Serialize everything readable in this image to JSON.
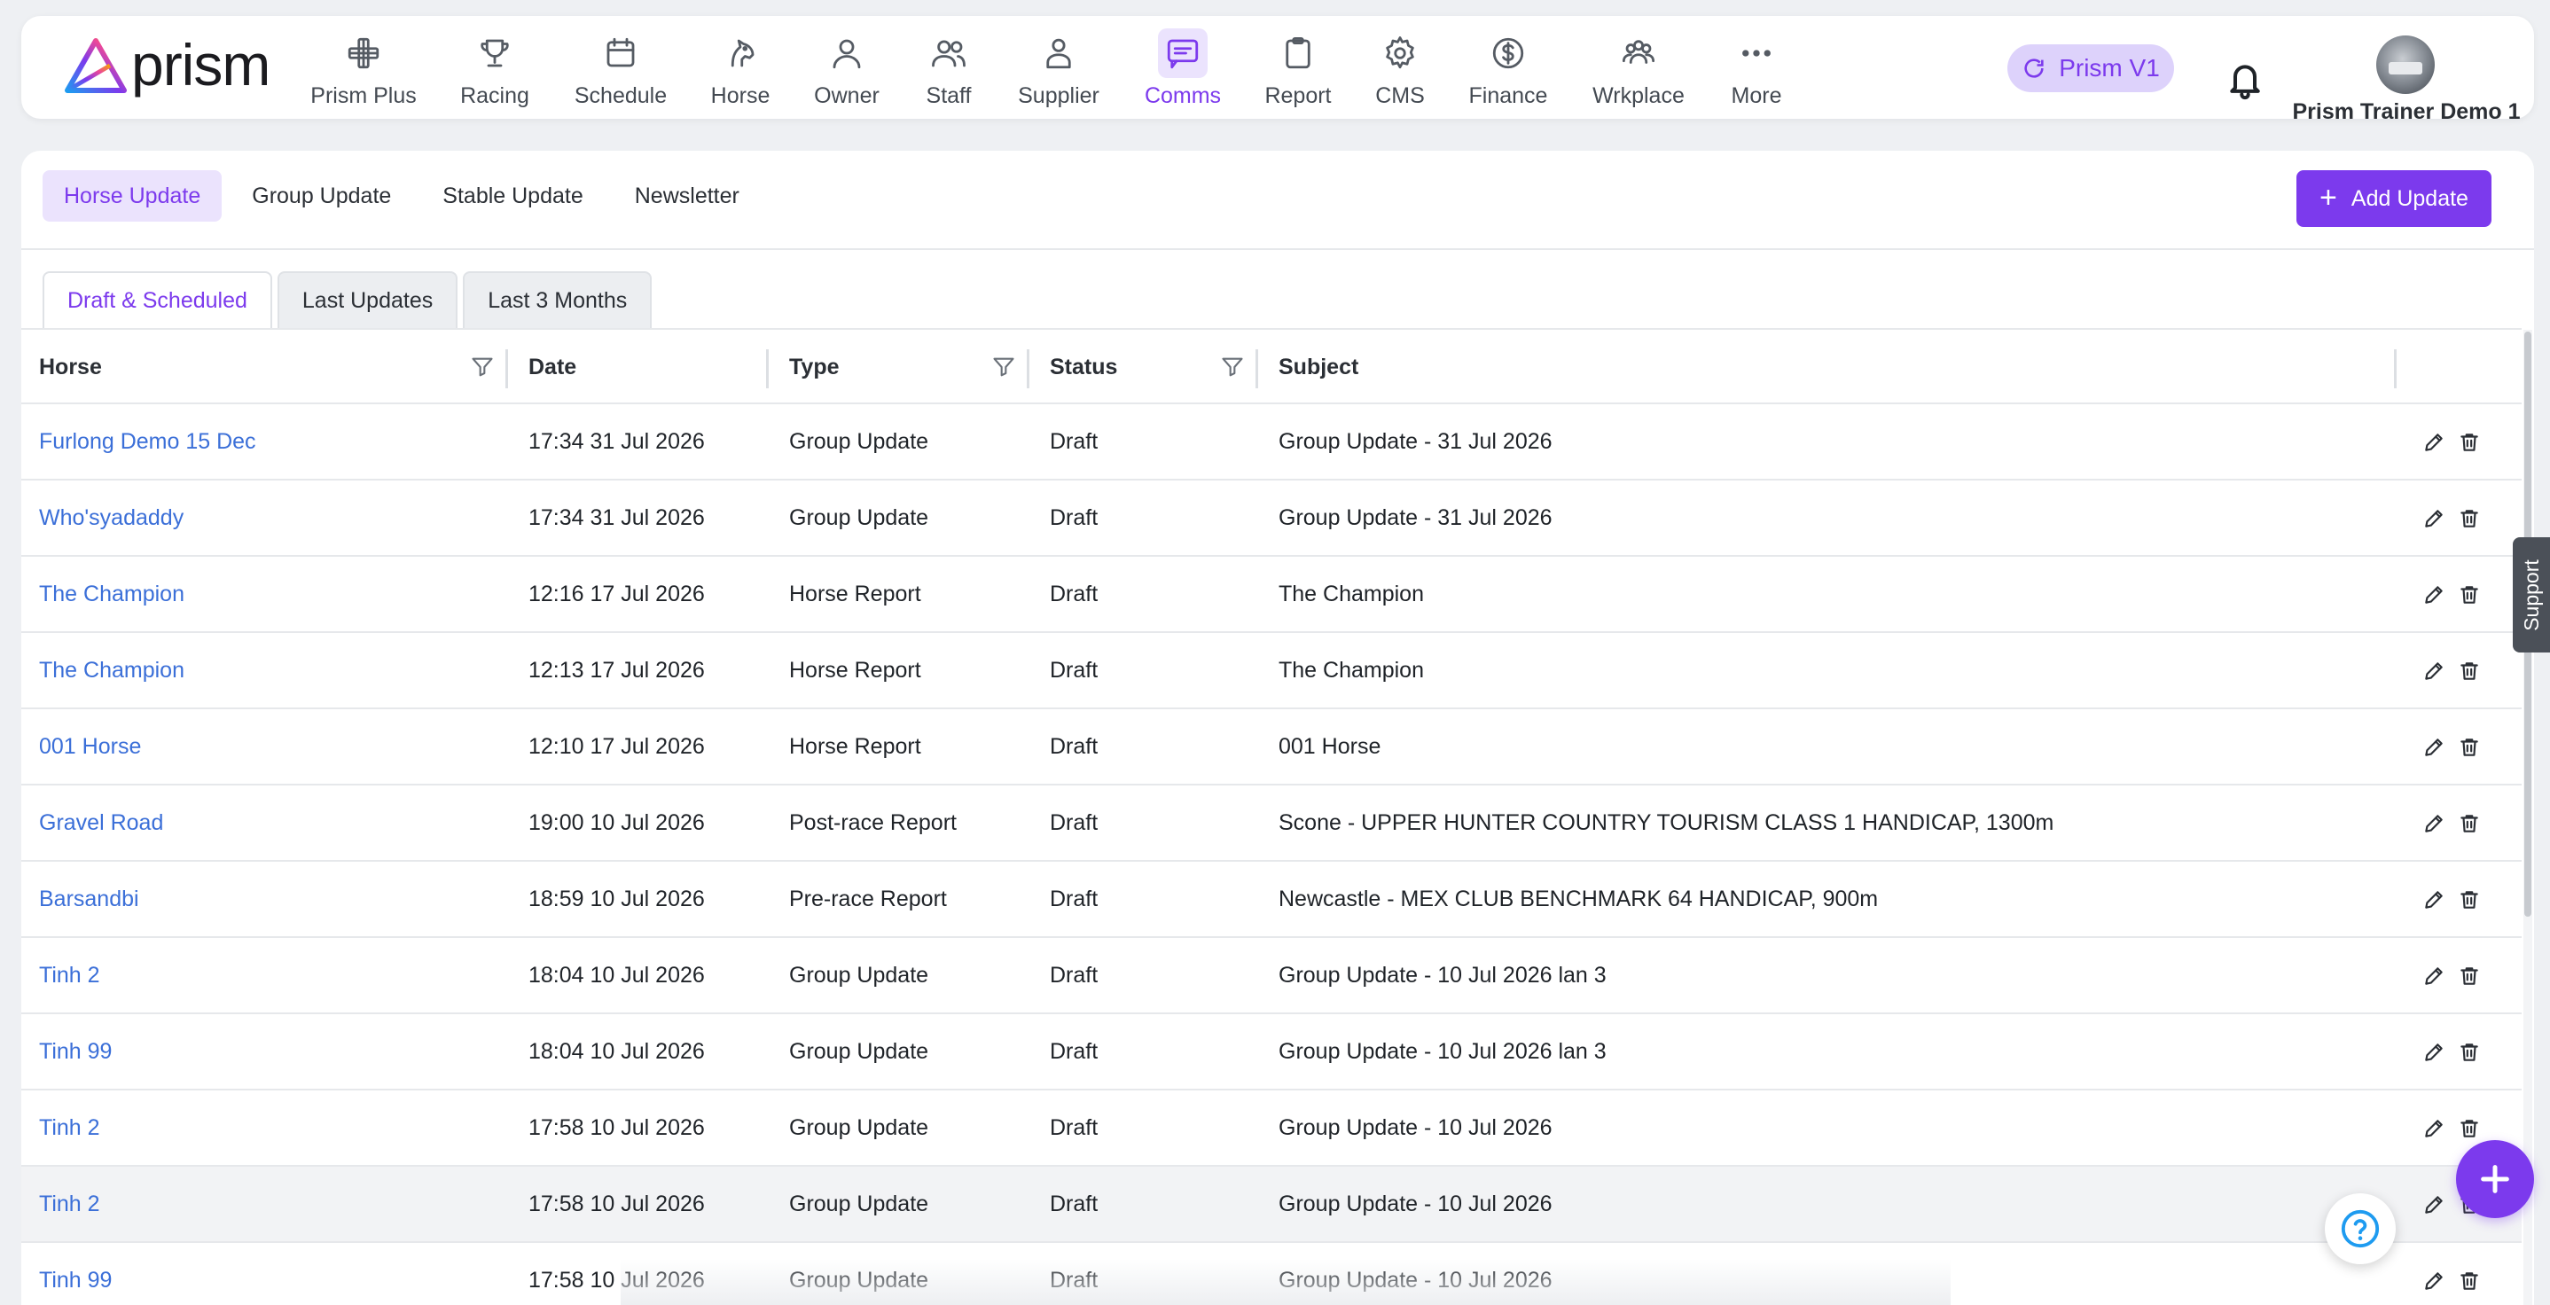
{
  "brand": {
    "logo_text": "prism"
  },
  "nav": [
    {
      "label": "Prism Plus",
      "icon": "prism-plus-icon"
    },
    {
      "label": "Racing",
      "icon": "trophy-icon"
    },
    {
      "label": "Schedule",
      "icon": "calendar-icon"
    },
    {
      "label": "Horse",
      "icon": "horse-head-icon"
    },
    {
      "label": "Owner",
      "icon": "user-icon"
    },
    {
      "label": "Staff",
      "icon": "users-icon"
    },
    {
      "label": "Supplier",
      "icon": "supplier-icon"
    },
    {
      "label": "Comms",
      "icon": "message-icon",
      "active": true
    },
    {
      "label": "Report",
      "icon": "clipboard-icon"
    },
    {
      "label": "CMS",
      "icon": "gear-icon"
    },
    {
      "label": "Finance",
      "icon": "dollar-icon"
    },
    {
      "label": "Wrkplace",
      "icon": "team-icon"
    },
    {
      "label": "More",
      "icon": "ellipsis-icon"
    }
  ],
  "header": {
    "version_label": "Prism V1",
    "user_name": "Prism Trainer Demo 1"
  },
  "subtabs": [
    {
      "label": "Horse Update",
      "active": true
    },
    {
      "label": "Group Update"
    },
    {
      "label": "Stable Update"
    },
    {
      "label": "Newsletter"
    }
  ],
  "add_button_label": "Add Update",
  "tabs": [
    {
      "label": "Draft & Scheduled",
      "active": true
    },
    {
      "label": "Last Updates"
    },
    {
      "label": "Last 3 Months"
    }
  ],
  "table": {
    "columns": {
      "horse": "Horse",
      "date": "Date",
      "type": "Type",
      "status": "Status",
      "subject": "Subject"
    },
    "rows": [
      {
        "horse": "Furlong Demo 15 Dec",
        "date": "17:34 31 Jul 2026",
        "type": "Group Update",
        "status": "Draft",
        "subject": "Group Update - 31 Jul 2026"
      },
      {
        "horse": "Who'syadaddy",
        "date": "17:34 31 Jul 2026",
        "type": "Group Update",
        "status": "Draft",
        "subject": "Group Update - 31 Jul 2026"
      },
      {
        "horse": "The Champion",
        "date": "12:16 17 Jul 2026",
        "type": "Horse Report",
        "status": "Draft",
        "subject": "The Champion"
      },
      {
        "horse": "The Champion",
        "date": "12:13 17 Jul 2026",
        "type": "Horse Report",
        "status": "Draft",
        "subject": "The Champion"
      },
      {
        "horse": "001 Horse",
        "date": "12:10 17 Jul 2026",
        "type": "Horse Report",
        "status": "Draft",
        "subject": "001 Horse"
      },
      {
        "horse": "Gravel Road",
        "date": "19:00 10 Jul 2026",
        "type": "Post-race Report",
        "status": "Draft",
        "subject": "Scone - UPPER HUNTER COUNTRY TOURISM CLASS 1 HANDICAP, 1300m"
      },
      {
        "horse": "Barsandbi",
        "date": "18:59 10 Jul 2026",
        "type": "Pre-race Report",
        "status": "Draft",
        "subject": "Newcastle - MEX CLUB BENCHMARK 64 HANDICAP, 900m"
      },
      {
        "horse": "Tinh 2",
        "date": "18:04 10 Jul 2026",
        "type": "Group Update",
        "status": "Draft",
        "subject": "Group Update - 10 Jul 2026 lan 3"
      },
      {
        "horse": "Tinh 99",
        "date": "18:04 10 Jul 2026",
        "type": "Group Update",
        "status": "Draft",
        "subject": "Group Update - 10 Jul 2026 lan 3"
      },
      {
        "horse": "Tinh 2",
        "date": "17:58 10 Jul 2026",
        "type": "Group Update",
        "status": "Draft",
        "subject": "Group Update - 10 Jul 2026"
      },
      {
        "horse": "Tinh 2",
        "date": "17:58 10 Jul 2026",
        "type": "Group Update",
        "status": "Draft",
        "subject": "Group Update - 10 Jul 2026",
        "hover": true
      },
      {
        "horse": "Tinh 99",
        "date": "17:58 10 Jul 2026",
        "type": "Group Update",
        "status": "Draft",
        "subject": "Group Update - 10 Jul 2026"
      }
    ]
  },
  "support_label": "Support",
  "colors": {
    "accent": "#7c3aed",
    "accent_soft": "#ebe3fd",
    "link": "#3b6fd8"
  }
}
